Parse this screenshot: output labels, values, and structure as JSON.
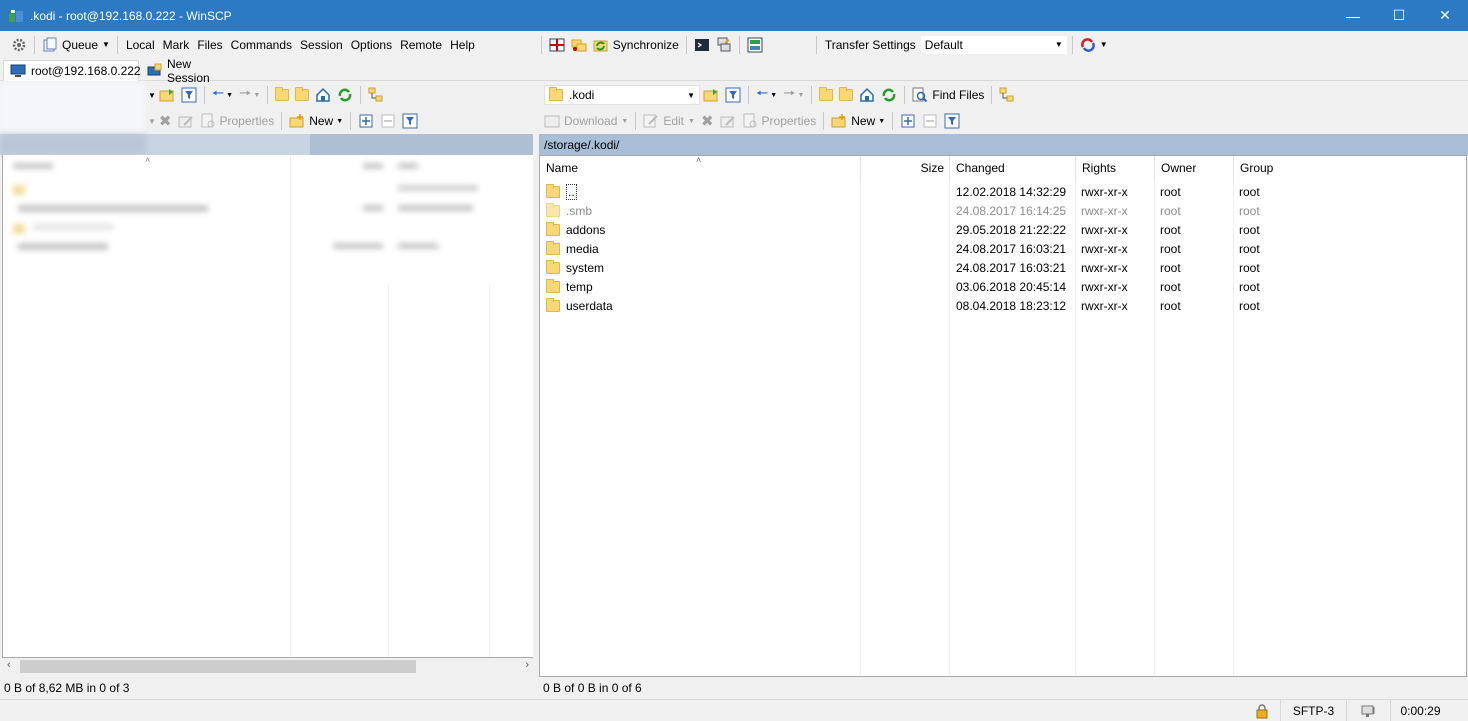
{
  "window": {
    "title": ".kodi - root@192.168.0.222 - WinSCP"
  },
  "menubar": {
    "queue_label": "Queue",
    "menus": [
      "Local",
      "Mark",
      "Files",
      "Commands",
      "Session",
      "Options",
      "Remote",
      "Help"
    ],
    "synchronize_label": "Synchronize",
    "transfer_settings_label": "Transfer Settings",
    "transfer_preset": "Default"
  },
  "tabs": [
    {
      "label": "root@192.168.0.222",
      "active": true
    },
    {
      "label": "New Session",
      "active": false
    }
  ],
  "local_panel": {
    "properties_label": "Properties",
    "new_label": "New",
    "status": "0 B of 8,62 MB in 0 of 3"
  },
  "remote_panel": {
    "location": ".kodi",
    "find_files_label": "Find Files",
    "download_label": "Download",
    "edit_label": "Edit",
    "properties_label": "Properties",
    "new_label": "New",
    "path": "/storage/.kodi/",
    "columns": [
      "Name",
      "Size",
      "Changed",
      "Rights",
      "Owner",
      "Group"
    ],
    "rows": [
      {
        "name": "..",
        "size": "",
        "changed": "12.02.2018 14:32:29",
        "rights": "rwxr-xr-x",
        "owner": "root",
        "group": "root",
        "hidden": false,
        "parent": true
      },
      {
        "name": ".smb",
        "size": "",
        "changed": "24.08.2017 16:14:25",
        "rights": "rwxr-xr-x",
        "owner": "root",
        "group": "root",
        "hidden": true,
        "parent": false
      },
      {
        "name": "addons",
        "size": "",
        "changed": "29.05.2018 21:22:22",
        "rights": "rwxr-xr-x",
        "owner": "root",
        "group": "root",
        "hidden": false,
        "parent": false
      },
      {
        "name": "media",
        "size": "",
        "changed": "24.08.2017 16:03:21",
        "rights": "rwxr-xr-x",
        "owner": "root",
        "group": "root",
        "hidden": false,
        "parent": false
      },
      {
        "name": "system",
        "size": "",
        "changed": "24.08.2017 16:03:21",
        "rights": "rwxr-xr-x",
        "owner": "root",
        "group": "root",
        "hidden": false,
        "parent": false
      },
      {
        "name": "temp",
        "size": "",
        "changed": "03.06.2018 20:45:14",
        "rights": "rwxr-xr-x",
        "owner": "root",
        "group": "root",
        "hidden": false,
        "parent": false
      },
      {
        "name": "userdata",
        "size": "",
        "changed": "08.04.2018 18:23:12",
        "rights": "rwxr-xr-x",
        "owner": "root",
        "group": "root",
        "hidden": false,
        "parent": false
      }
    ],
    "status": "0 B of 0 B in 0 of 6"
  },
  "statusbar": {
    "protocol": "SFTP-3",
    "elapsed": "0:00:29"
  }
}
